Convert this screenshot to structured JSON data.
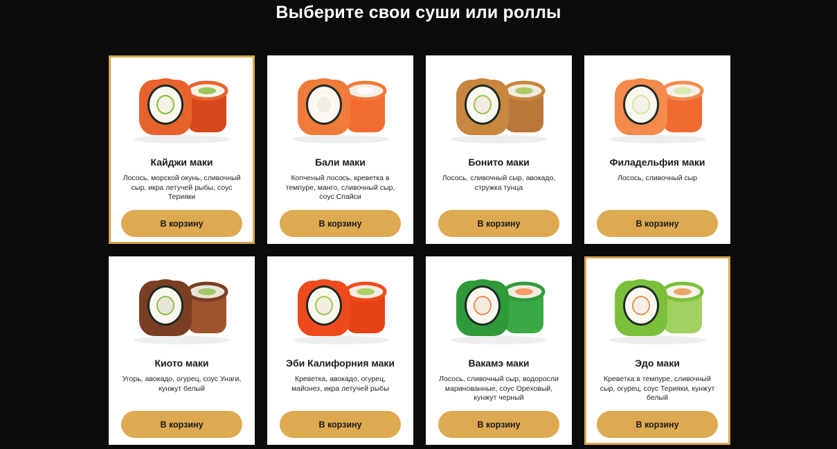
{
  "page": {
    "title": "Выберите свои суши или роллы"
  },
  "products": [
    {
      "name": "Кайджи маки",
      "description": "Лосось, морской окунь, сливочный сыр, икра летучей рыбы, соус Терияки",
      "button": "В корзину",
      "active": true,
      "icon": "roll-image",
      "colors": {
        "outer": "#e8622e",
        "filling": "#f7f1e6",
        "side": "#d8481d",
        "garnish": "#7fbf3a"
      }
    },
    {
      "name": "Бали маки",
      "description": "Копченый лосось, креветка в темпуре, манго, сливочный сыр, соус Спайси",
      "button": "В корзину",
      "active": false,
      "icon": "roll-image",
      "colors": {
        "outer": "#f07a3a",
        "filling": "#f4efe6",
        "side": "#f26c2f",
        "garnish": "#ffffff"
      }
    },
    {
      "name": "Бонито маки",
      "description": "Лосось, сливочный сыр, авокадо, стружка тунца",
      "button": "В корзину",
      "active": false,
      "icon": "roll-image",
      "colors": {
        "outer": "#c8863f",
        "filling": "#f2ebdf",
        "side": "#b9773a",
        "garnish": "#9ac24a"
      }
    },
    {
      "name": "Филадельфия маки",
      "description": "Лосось, сливочный сыр",
      "button": "В корзину",
      "active": false,
      "icon": "roll-image",
      "colors": {
        "outer": "#f48a4c",
        "filling": "#f5f0e8",
        "side": "#f06a32",
        "garnish": "#cfe8a0"
      }
    },
    {
      "name": "Киото маки",
      "description": "Угорь, авокадо, огурец, соус Унаги, кунжут белый",
      "button": "В корзину",
      "active": false,
      "icon": "roll-image",
      "colors": {
        "outer": "#7a3e22",
        "filling": "#e9e4d8",
        "side": "#a0542e",
        "garnish": "#8fbf4a"
      }
    },
    {
      "name": "Эби Калифорния маки",
      "description": "Креветка, авокадо, огурец, майонез, икра летучей рыбы",
      "button": "В корзину",
      "active": false,
      "icon": "roll-image",
      "colors": {
        "outer": "#ef4a1b",
        "filling": "#f3ece0",
        "side": "#e54317",
        "garnish": "#9cc84a"
      }
    },
    {
      "name": "Вакамэ маки",
      "description": "Лосось, сливочный сыр, водоросли маринованные, соус Ореховый, кунжут черный",
      "button": "В корзину",
      "active": false,
      "icon": "roll-image",
      "colors": {
        "outer": "#2f9a3a",
        "filling": "#f1ebe0",
        "side": "#3aa844",
        "garnish": "#f08a4a"
      }
    },
    {
      "name": "Эдо маки",
      "description": "Креветка в темпуре, сливочный сыр, огурец, соус Терияки, кунжут белый",
      "button": "В корзину",
      "active": true,
      "icon": "roll-image",
      "colors": {
        "outer": "#7cbf3a",
        "filling": "#f6f1e8",
        "side": "#9fd060",
        "garnish": "#e8924a"
      }
    }
  ]
}
